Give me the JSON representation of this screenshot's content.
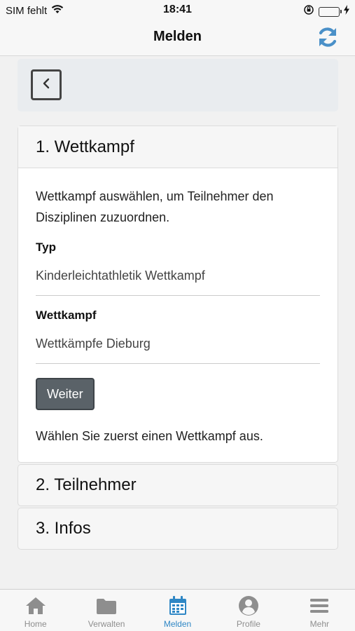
{
  "status_bar": {
    "carrier": "SIM fehlt",
    "time": "18:41",
    "battery_level": 1.0
  },
  "nav": {
    "title": "Melden",
    "refresh_icon": "refresh-icon"
  },
  "colors": {
    "accent": "#2f87c5",
    "button_bg": "#5a6268",
    "battery": "#35c24a"
  },
  "steps": [
    {
      "title": "1. Wettkampf",
      "description": "Wettkampf auswählen, um Teilnehmer den Disziplinen zuzuordnen.",
      "fields": [
        {
          "label": "Typ",
          "value": "Kinderleichtathletik Wettkampf"
        },
        {
          "label": "Wettkampf",
          "value": "Wettkämpfe Dieburg"
        }
      ],
      "button_label": "Weiter",
      "hint": "Wählen Sie zuerst einen Wettkampf aus."
    },
    {
      "title": "2. Teilnehmer"
    },
    {
      "title": "3. Infos"
    }
  ],
  "tabs": [
    {
      "label": "Home",
      "icon": "home-icon"
    },
    {
      "label": "Verwalten",
      "icon": "folder-icon"
    },
    {
      "label": "Melden",
      "icon": "calendar-icon"
    },
    {
      "label": "Profile",
      "icon": "user-circle-icon"
    },
    {
      "label": "Mehr",
      "icon": "menu-icon"
    }
  ],
  "active_tab": "Melden"
}
